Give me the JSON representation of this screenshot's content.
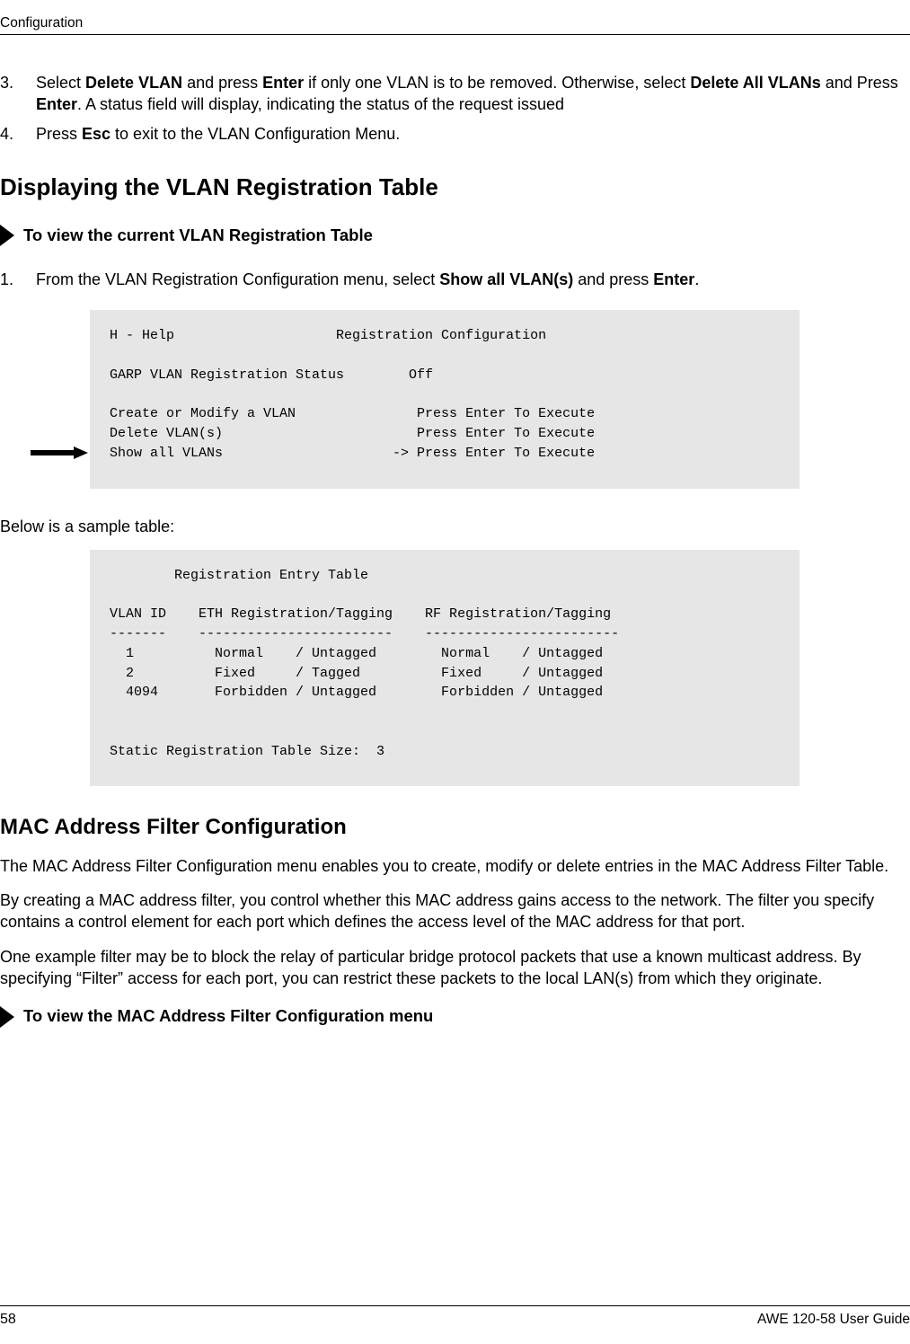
{
  "header": {
    "title": "Configuration"
  },
  "steps_top": [
    {
      "num": "3.",
      "segments": [
        {
          "t": "Select "
        },
        {
          "t": "Delete VLAN",
          "b": true
        },
        {
          "t": " and press "
        },
        {
          "t": "Enter",
          "b": true
        },
        {
          "t": " if only one VLAN is to be removed. Otherwise, select "
        },
        {
          "t": "Delete All VLANs",
          "b": true
        },
        {
          "t": " and Press "
        },
        {
          "t": "Enter",
          "b": true
        },
        {
          "t": ". A status field will display, indicating the status of the request issued"
        }
      ]
    },
    {
      "num": "4.",
      "segments": [
        {
          "t": "Press "
        },
        {
          "t": "Esc",
          "b": true
        },
        {
          "t": " to exit to the VLAN Configuration Menu."
        }
      ]
    }
  ],
  "heading1": "Displaying the VLAN Registration Table",
  "arrow1_label": "To view the current VLAN Registration Table",
  "step1": {
    "num": "1.",
    "segments": [
      {
        "t": "From the VLAN Registration Configuration menu, select "
      },
      {
        "t": "Show all VLAN(s)",
        "b": true
      },
      {
        "t": "  and press "
      },
      {
        "t": "Enter",
        "b": true
      },
      {
        "t": "."
      }
    ]
  },
  "codeblock1": "H - Help                    Registration Configuration\n\nGARP VLAN Registration Status        Off\n\nCreate or Modify a VLAN               Press Enter To Execute\nDelete VLAN(s)                        Press Enter To Execute\nShow all VLANs                     -> Press Enter To Execute",
  "below_sample_label": "Below is a sample table:",
  "codeblock2": "        Registration Entry Table\n\nVLAN ID    ETH Registration/Tagging    RF Registration/Tagging\n-------    ------------------------    ------------------------\n  1          Normal    / Untagged        Normal    / Untagged\n  2          Fixed     / Tagged          Fixed     / Untagged\n  4094       Forbidden / Untagged        Forbidden / Untagged\n\n\nStatic Registration Table Size:  3",
  "chart_data": {
    "type": "table",
    "title": "Registration Entry Table",
    "columns": [
      "VLAN ID",
      "ETH Registration",
      "ETH Tagging",
      "RF Registration",
      "RF Tagging"
    ],
    "rows": [
      [
        "1",
        "Normal",
        "Untagged",
        "Normal",
        "Untagged"
      ],
      [
        "2",
        "Fixed",
        "Tagged",
        "Fixed",
        "Untagged"
      ],
      [
        "4094",
        "Forbidden",
        "Untagged",
        "Forbidden",
        "Untagged"
      ]
    ],
    "footer": "Static Registration Table Size:  3"
  },
  "heading2": "MAC Address Filter Configuration",
  "para1": "The MAC Address Filter Configuration menu enables you to create, modify or delete entries in the MAC Address Filter Table.",
  "para2": "By creating a MAC address filter, you control whether this MAC address gains access to the network.   The filter you specify contains a control element for each port which defines the access level of the MAC address for that port.",
  "para3": "One example filter may be to block the relay of particular bridge protocol packets that use a known multicast address. By specifying “Filter” access for each port, you can restrict these packets to the local LAN(s) from which they originate.",
  "arrow2_label": "To view the MAC Address Filter Configuration menu",
  "footer": {
    "page": "58",
    "guide": "AWE 120-58 User Guide"
  }
}
